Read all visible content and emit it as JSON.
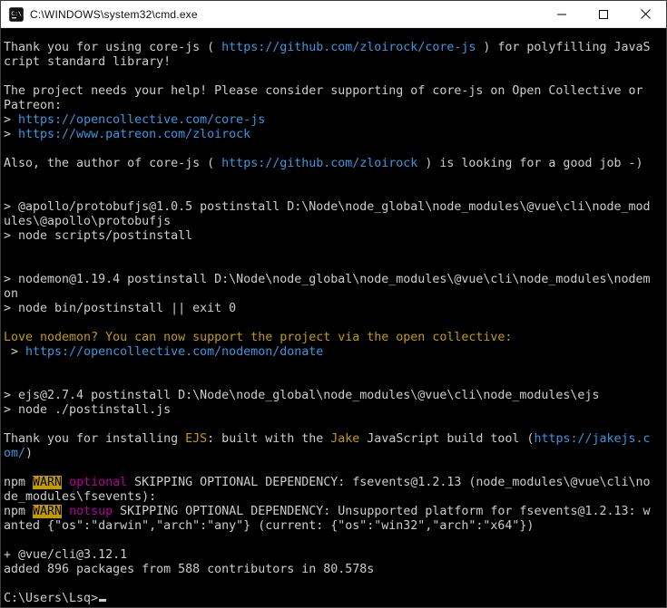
{
  "window": {
    "title": "C:\\WINDOWS\\system32\\cmd.exe"
  },
  "icons": {
    "app": "cmd-icon",
    "minimize": "minimize-icon",
    "maximize": "maximize-icon",
    "close": "close-icon"
  },
  "palette": {
    "fg": {
      "color": "#cccccc"
    },
    "link": {
      "color": "#3a96dd"
    },
    "yellow": {
      "color": "#c19c00"
    },
    "magenta": {
      "color": "#b4009e"
    },
    "warn": {
      "color": "#000000",
      "bg": "#c19c00"
    }
  },
  "terminal": {
    "background": "#000000",
    "prompt": "C:\\Users\\Lsq>",
    "lines": [
      {
        "segs": [
          {
            "t": "Thank you for using core-js ( ",
            "c": "fg"
          },
          {
            "t": "https://github.com/zloirock/core-js",
            "c": "link"
          },
          {
            "t": " ) for polyfilling JavaS",
            "c": "fg"
          }
        ]
      },
      {
        "segs": [
          {
            "t": "cript standard library!",
            "c": "fg"
          }
        ]
      },
      {
        "segs": []
      },
      {
        "segs": [
          {
            "t": "The project needs your help! Please consider supporting of core-js on Open Collective or",
            "c": "fg"
          }
        ]
      },
      {
        "segs": [
          {
            "t": "Patreon:",
            "c": "fg"
          }
        ]
      },
      {
        "segs": [
          {
            "t": "> ",
            "c": "fg"
          },
          {
            "t": "https://opencollective.com/core-js",
            "c": "link"
          }
        ]
      },
      {
        "segs": [
          {
            "t": "> ",
            "c": "fg"
          },
          {
            "t": "https://www.patreon.com/zloirock",
            "c": "link"
          }
        ]
      },
      {
        "segs": []
      },
      {
        "segs": [
          {
            "t": "Also, the author of core-js ( ",
            "c": "fg"
          },
          {
            "t": "https://github.com/zloirock",
            "c": "link"
          },
          {
            "t": " ) is looking for a good job -)",
            "c": "fg"
          }
        ]
      },
      {
        "segs": []
      },
      {
        "segs": []
      },
      {
        "segs": [
          {
            "t": "> @apollo/protobufjs@1.0.5 postinstall D:\\Node\\node_global\\node_modules\\@vue\\cli\\node_mod",
            "c": "fg"
          }
        ]
      },
      {
        "segs": [
          {
            "t": "ules\\@apollo\\protobufjs",
            "c": "fg"
          }
        ]
      },
      {
        "segs": [
          {
            "t": "> node scripts/postinstall",
            "c": "fg"
          }
        ]
      },
      {
        "segs": []
      },
      {
        "segs": []
      },
      {
        "segs": [
          {
            "t": "> nodemon@1.19.4 postinstall D:\\Node\\node_global\\node_modules\\@vue\\cli\\node_modules\\nodem",
            "c": "fg"
          }
        ]
      },
      {
        "segs": [
          {
            "t": "on",
            "c": "fg"
          }
        ]
      },
      {
        "segs": [
          {
            "t": "> node bin/postinstall || exit 0",
            "c": "fg"
          }
        ]
      },
      {
        "segs": []
      },
      {
        "segs": [
          {
            "t": "Love nodemon? You can now support the project via the open collective:",
            "c": "yellow"
          }
        ]
      },
      {
        "segs": [
          {
            "t": " > ",
            "c": "fg"
          },
          {
            "t": "https://opencollective.com/nodemon/donate",
            "c": "link"
          }
        ]
      },
      {
        "segs": []
      },
      {
        "segs": []
      },
      {
        "segs": [
          {
            "t": "> ejs@2.7.4 postinstall D:\\Node\\node_global\\node_modules\\@vue\\cli\\node_modules\\ejs",
            "c": "fg"
          }
        ]
      },
      {
        "segs": [
          {
            "t": "> node ./postinstall.js",
            "c": "fg"
          }
        ]
      },
      {
        "segs": []
      },
      {
        "segs": [
          {
            "t": "Thank you for installing ",
            "c": "fg"
          },
          {
            "t": "EJS",
            "c": "yellow"
          },
          {
            "t": ": built with the ",
            "c": "fg"
          },
          {
            "t": "Jake",
            "c": "yellow"
          },
          {
            "t": " JavaScript build tool (",
            "c": "fg"
          },
          {
            "t": "https://jakejs.c",
            "c": "link"
          }
        ]
      },
      {
        "segs": [
          {
            "t": "om/",
            "c": "link"
          },
          {
            "t": ")",
            "c": "fg"
          }
        ]
      },
      {
        "segs": []
      },
      {
        "segs": [
          {
            "t": "npm ",
            "c": "fg"
          },
          {
            "t": "WARN",
            "c": "warn"
          },
          {
            "t": " ",
            "c": "fg"
          },
          {
            "t": "optional",
            "c": "magenta"
          },
          {
            "t": " SKIPPING OPTIONAL DEPENDENCY: fsevents@1.2.13 (node_modules\\@vue\\cli\\no",
            "c": "fg"
          }
        ]
      },
      {
        "segs": [
          {
            "t": "de_modules\\fsevents):",
            "c": "fg"
          }
        ]
      },
      {
        "segs": [
          {
            "t": "npm ",
            "c": "fg"
          },
          {
            "t": "WARN",
            "c": "warn"
          },
          {
            "t": " ",
            "c": "fg"
          },
          {
            "t": "notsup",
            "c": "magenta"
          },
          {
            "t": " SKIPPING OPTIONAL DEPENDENCY: Unsupported platform for fsevents@1.2.13: w",
            "c": "fg"
          }
        ]
      },
      {
        "segs": [
          {
            "t": "anted {\"os\":\"darwin\",\"arch\":\"any\"} (current: {\"os\":\"win32\",\"arch\":\"x64\"})",
            "c": "fg"
          }
        ]
      },
      {
        "segs": []
      },
      {
        "segs": [
          {
            "t": "+ @vue/cli@3.12.1",
            "c": "fg"
          }
        ]
      },
      {
        "segs": [
          {
            "t": "added 896 packages from 588 contributors in 80.578s",
            "c": "fg"
          }
        ]
      },
      {
        "segs": []
      },
      {
        "segs": [
          {
            "t": "C:\\Users\\Lsq>",
            "c": "fg"
          }
        ],
        "cursor": true
      }
    ]
  }
}
